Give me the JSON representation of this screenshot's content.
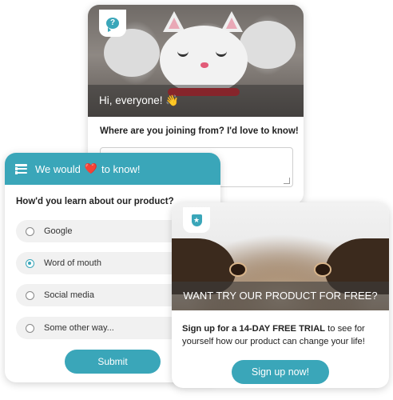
{
  "question_card": {
    "greeting": "Hi, everyone! 👋",
    "question": "Where are you joining from? I'd love to know!",
    "icon": "chat-bubble-question-icon"
  },
  "poll_card": {
    "header_prefix": "We would",
    "header_heart": "❤️",
    "header_suffix": "to know!",
    "question": "How'd you learn about our product?",
    "options": [
      "Google",
      "Word of mouth",
      "Social media",
      "Some other way..."
    ],
    "selected_option": "Word of mouth",
    "submit_label": "Submit",
    "accent": "#3aa6b9",
    "icon": "list-icon"
  },
  "trial_card": {
    "banner": "WANT TRY OUR PRODUCT FOR FREE?",
    "desc_bold": "Sign up for a 14-DAY FREE TRIAL",
    "desc_rest": " to see for yourself how our product can change your life!",
    "button_label": "Sign up now!",
    "icon": "star-shield-icon"
  }
}
